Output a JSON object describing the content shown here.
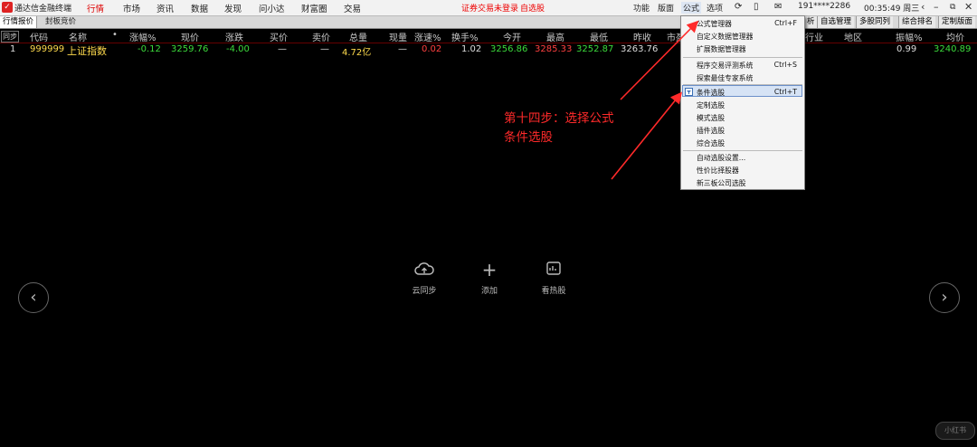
{
  "app": {
    "title": "通达信金融终端",
    "logo_glyph": "✓"
  },
  "menu": {
    "items": [
      "行情",
      "市场",
      "资讯",
      "数据",
      "发现",
      "问小达",
      "财富圈",
      "交易"
    ],
    "active": "行情"
  },
  "status": {
    "login": "证券交易未登录",
    "fav_stock": "自选股"
  },
  "right_menu": {
    "items": [
      "功能",
      "版面",
      "公式",
      "选项"
    ],
    "user": "191****2286",
    "time": "00:35:49 周三"
  },
  "tabs": {
    "main": "行情报价",
    "second": "封板竞价"
  },
  "right_tabs": [
    "析",
    "自选管理",
    "多股同列",
    "综合排名",
    "定制版面"
  ],
  "columns": {
    "sync": "同步",
    "left": [
      "代码",
      "名称",
      "•",
      "涨幅%",
      "现价",
      "涨跌",
      "买价",
      "卖价",
      "总量",
      "现量",
      "涨速%",
      "换手%",
      "今开",
      "最高",
      "最低",
      "昨收",
      "市盈"
    ],
    "right": [
      "行业",
      "地区",
      "振幅%",
      "均价"
    ]
  },
  "row": {
    "index": "1",
    "code": "999999",
    "name": "上证指数",
    "change_pct": "-0.12",
    "price": "3259.76",
    "change": "-4.00",
    "bid": "—",
    "ask": "—",
    "volume": "4.72亿",
    "cur_vol": "—",
    "speed": "0.02",
    "turnover": "1.02",
    "open": "3256.86",
    "high": "3285.33",
    "low": "3252.87",
    "prev_close": "3263.76",
    "amplitude": "0.99",
    "avg_price": "3240.89"
  },
  "dropdown": {
    "items": [
      {
        "label": "公式管理器",
        "shortcut": "Ctrl+F"
      },
      {
        "label": "自定义数据管理器",
        "shortcut": ""
      },
      {
        "label": "扩展数据管理器",
        "shortcut": ""
      },
      {
        "label": "程序交易评测系统",
        "shortcut": "Ctrl+S"
      },
      {
        "label": "探索最佳专家系统",
        "shortcut": ""
      },
      {
        "label": "条件选股",
        "shortcut": "Ctrl+T"
      },
      {
        "label": "定制选股",
        "shortcut": ""
      },
      {
        "label": "模式选股",
        "shortcut": ""
      },
      {
        "label": "插件选股",
        "shortcut": ""
      },
      {
        "label": "综合选股",
        "shortcut": ""
      },
      {
        "label": "自动选股设置...",
        "shortcut": ""
      },
      {
        "label": "性价比择股器",
        "shortcut": ""
      },
      {
        "label": "新三板公司选股",
        "shortcut": ""
      }
    ],
    "highlighted": "条件选股"
  },
  "annotation": {
    "line1": "第十四步：选择公式",
    "line2": "条件选股",
    "color": "#ff2a2a"
  },
  "center": {
    "cloud_label": "云同步",
    "add_label": "添加",
    "hot_label": "看热股",
    "prev_glyph": "‹",
    "next_glyph": "›"
  },
  "watermark": "小红书"
}
